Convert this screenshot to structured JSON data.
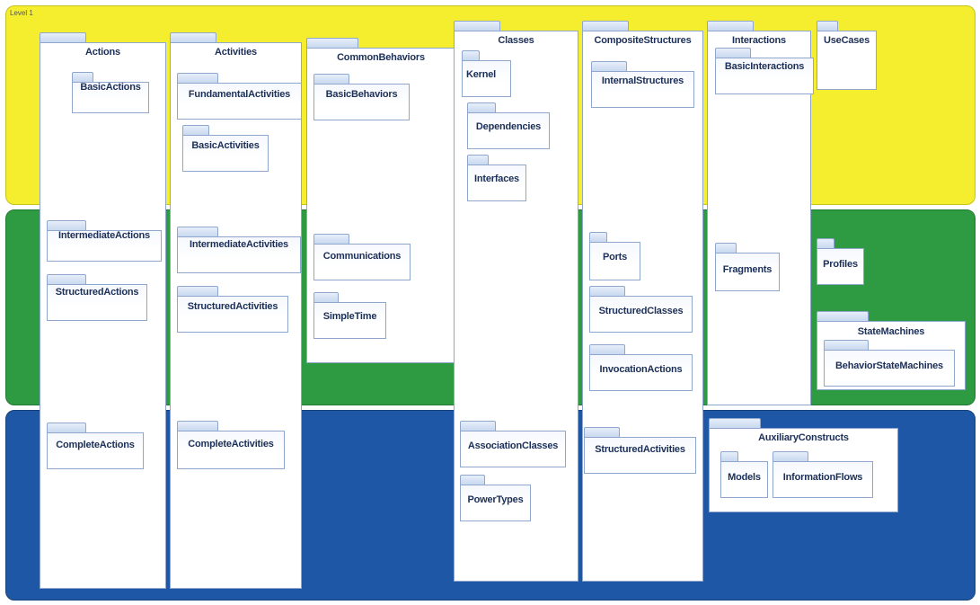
{
  "level_label": "Level 1",
  "columns": {
    "actions": "Actions",
    "activities": "Activities",
    "common_behaviors": "CommonBehaviors",
    "classes": "Classes",
    "composite_structures": "CompositeStructures",
    "interactions": "Interactions",
    "use_cases": "UseCases"
  },
  "packages": {
    "basic_actions": "BasicActions",
    "intermediate_actions": "IntermediateActions",
    "structured_actions": "StructuredActions",
    "complete_actions": "CompleteActions",
    "fundamental_activities": "FundamentalActivities",
    "basic_activities": "BasicActivities",
    "intermediate_activities": "IntermediateActivities",
    "structured_activities": "StructuredActivities",
    "complete_activities": "CompleteActivities",
    "basic_behaviors": "BasicBehaviors",
    "communications": "Communications",
    "simple_time": "SimpleTime",
    "kernel": "Kernel",
    "dependencies": "Dependencies",
    "interfaces": "Interfaces",
    "association_classes": "AssociationClasses",
    "power_types": "PowerTypes",
    "internal_structures": "InternalStructures",
    "ports": "Ports",
    "structured_classes": "StructuredClasses",
    "invocation_actions": "InvocationActions",
    "cs_structured_activities": "StructuredActivities",
    "basic_interactions": "BasicInteractions",
    "fragments": "Fragments",
    "profiles": "Profiles",
    "state_machines": "StateMachines",
    "behavior_state_machines": "BehaviorStateMachines",
    "auxiliary_constructs": "AuxiliaryConstructs",
    "models": "Models",
    "information_flows": "InformationFlows"
  },
  "colors": {
    "level1": "#f4ee2f",
    "level2": "#2e9a42",
    "level3": "#1f57a7",
    "package_border": "#8fa7cc",
    "package_title": "#1c2f57"
  }
}
